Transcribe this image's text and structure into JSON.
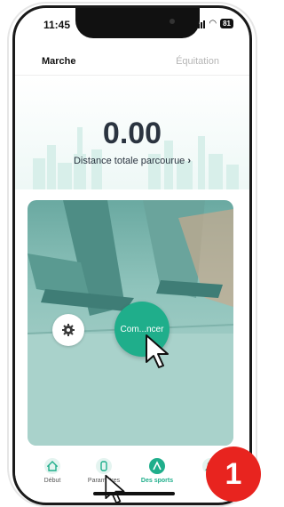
{
  "status_bar": {
    "time": "11:45",
    "battery": "81"
  },
  "tabs": [
    {
      "label": "Marche",
      "active": true
    },
    {
      "label": "Équitation",
      "active": false
    }
  ],
  "summary": {
    "value": "0.00",
    "label": "Distance totale parcourue"
  },
  "card": {
    "settings_icon": "gear-icon",
    "start_button_label": "Com...ncer"
  },
  "bottom_nav": [
    {
      "label": "Début",
      "icon": "home-icon",
      "active": false
    },
    {
      "label": "Paramètres",
      "icon": "watch-icon",
      "active": false
    },
    {
      "label": "Des sports",
      "icon": "sports-icon",
      "active": true
    },
    {
      "label": "",
      "icon": "profile-icon",
      "active": false
    }
  ],
  "step_badge": "1",
  "colors": {
    "accent": "#1fae8b",
    "badge": "#e8241f",
    "text": "#2b3440"
  }
}
